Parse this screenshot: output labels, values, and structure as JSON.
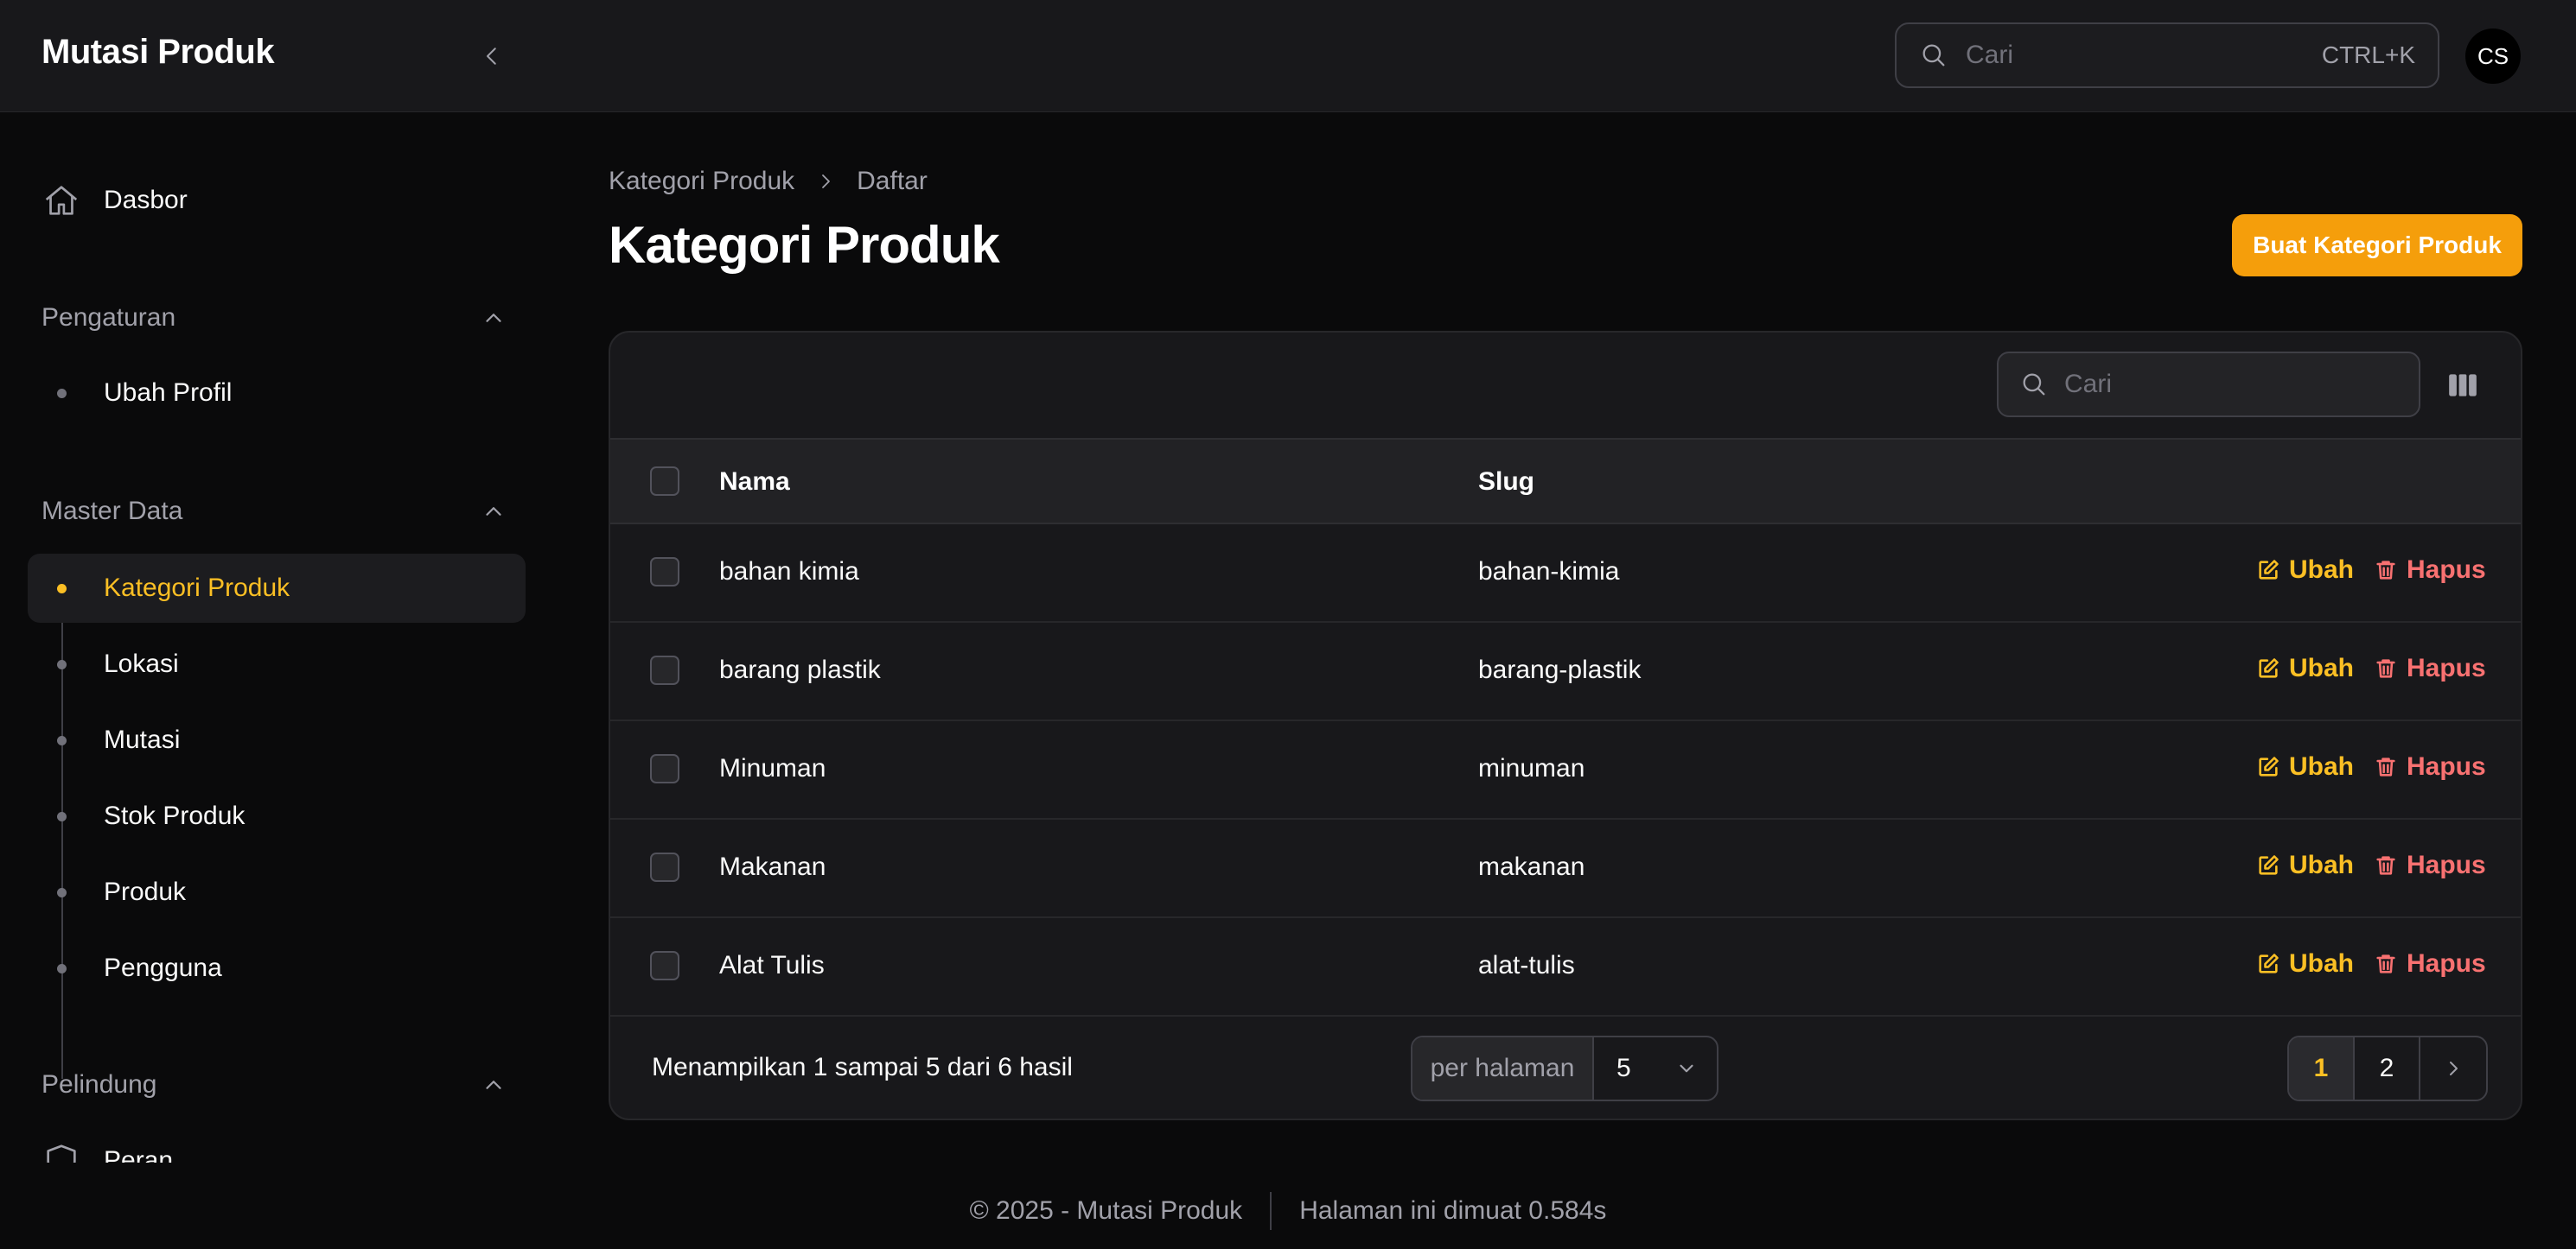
{
  "app": {
    "title": "Mutasi Produk"
  },
  "header": {
    "search_placeholder": "Cari",
    "search_shortcut": "CTRL+K",
    "avatar_initials": "CS"
  },
  "sidebar": {
    "dashboard_label": "Dasbor",
    "groups": [
      {
        "title": "Pengaturan",
        "items": [
          {
            "label": "Ubah Profil"
          }
        ]
      },
      {
        "title": "Master Data",
        "items": [
          {
            "label": "Kategori Produk",
            "active": true
          },
          {
            "label": "Lokasi"
          },
          {
            "label": "Mutasi"
          },
          {
            "label": "Stok Produk"
          },
          {
            "label": "Produk"
          },
          {
            "label": "Pengguna"
          }
        ]
      },
      {
        "title": "Pelindung",
        "items": [
          {
            "label": "Peran"
          }
        ]
      }
    ]
  },
  "main": {
    "breadcrumb": [
      "Kategori Produk",
      "Daftar"
    ],
    "title": "Kategori Produk",
    "create_button": "Buat Kategori Produk"
  },
  "table": {
    "search_placeholder": "Cari",
    "columns": [
      "Nama",
      "Slug"
    ],
    "rows": [
      {
        "nama": "bahan kimia",
        "slug": "bahan-kimia"
      },
      {
        "nama": "barang plastik",
        "slug": "barang-plastik"
      },
      {
        "nama": "Minuman",
        "slug": "minuman"
      },
      {
        "nama": "Makanan",
        "slug": "makanan"
      },
      {
        "nama": "Alat Tulis",
        "slug": "alat-tulis"
      }
    ],
    "edit_label": "Ubah",
    "delete_label": "Hapus",
    "summary": "Menampilkan 1 sampai 5 dari 6 hasil",
    "per_page_label": "per halaman",
    "per_page_value": "5",
    "pages": [
      "1",
      "2"
    ],
    "current_page": "1"
  },
  "footer": {
    "copyright": "© 2025 - Mutasi Produk",
    "load_time": "Halaman ini dimuat 0.584s"
  },
  "colors": {
    "accent": "#f59e0b",
    "accent_text": "#fbbf24",
    "danger": "#f87171",
    "background": "#0a0a0b",
    "surface": "#18181b"
  }
}
